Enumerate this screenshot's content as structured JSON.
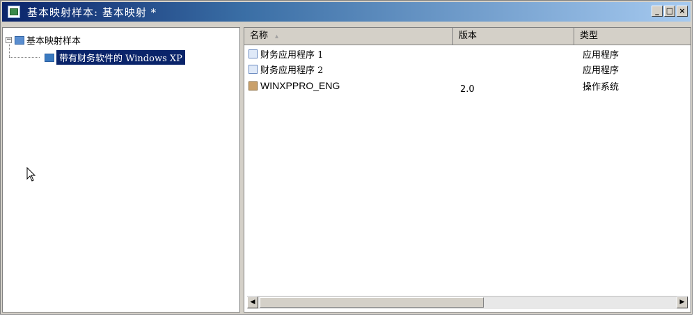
{
  "window": {
    "title": "基本映射样本: 基本映射 *",
    "controls": {
      "minimize": "_",
      "maximize": "□",
      "close": "×"
    }
  },
  "tree": {
    "root": {
      "label": "基本映射样本",
      "expander": "−"
    },
    "child": {
      "label": "带有财务软件的 Windows XP"
    }
  },
  "list": {
    "columns": [
      "名称",
      "版本",
      "类型"
    ],
    "rows": [
      {
        "name": "财务应用程序 1",
        "version": "",
        "type": "应用程序",
        "icon": "application-icon"
      },
      {
        "name": "财务应用程序 2",
        "version": "",
        "type": "应用程序",
        "icon": "application-icon"
      },
      {
        "name": "WINXPPRO_ENG",
        "version": "2.0",
        "type": "操作系统",
        "icon": "os-image-icon"
      }
    ]
  },
  "scrollbar": {
    "left_arrow": "◀",
    "right_arrow": "▶"
  },
  "colors": {
    "selection": "#0a246a",
    "titlebar_start": "#0a246a",
    "titlebar_end": "#a6caf0"
  }
}
